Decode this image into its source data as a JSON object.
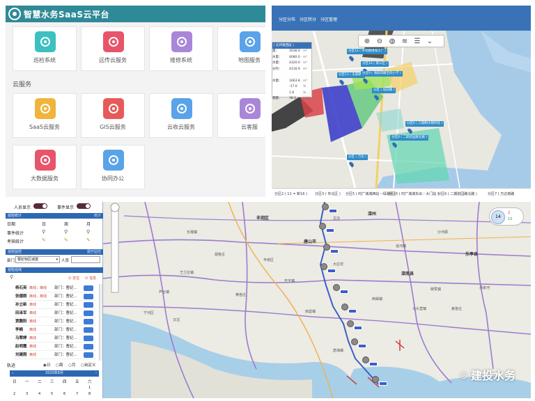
{
  "saas": {
    "title": "智慧水务SaaS云平台",
    "section": "云服务",
    "row1": [
      {
        "label": "巡检系统",
        "color": "#3cc0c0"
      },
      {
        "label": "远传云服务",
        "color": "#e8546a"
      },
      {
        "label": "维修系统",
        "color": "#a987d8"
      },
      {
        "label": "地图服务",
        "color": "#5aa3e8"
      }
    ],
    "row2": [
      {
        "label": "SaaS云服务",
        "color": "#f0b43c"
      },
      {
        "label": "GIS云服务",
        "color": "#e85a5a"
      },
      {
        "label": "云收云服务",
        "color": "#5aa3e8"
      },
      {
        "label": "云客服",
        "color": "#a987d8"
      }
    ],
    "row3": [
      {
        "label": "大数据服务",
        "color": "#e8546a"
      },
      {
        "label": "协同办公",
        "color": "#5aa3e8"
      }
    ]
  },
  "dispatch": {
    "nav": [
      "分区分布",
      "分区转分",
      "分区管理"
    ],
    "table": {
      "header": "( 北环路西段 )",
      "rows": [
        {
          "k": "量：",
          "v": "1636.0",
          "u": "m³"
        },
        {
          "k": "水量：",
          "v": "4080.0",
          "u": "m³"
        },
        {
          "k": "水量：",
          "v": "4320.0",
          "u": "m³"
        },
        {
          "k": "分时：",
          "v": "4116.9",
          "u": "m³"
        },
        {
          "k": "",
          "v": "",
          "u": ""
        },
        {
          "k": "水量：",
          "v": "1663.8",
          "u": "m³"
        },
        {
          "k": "",
          ":": "",
          "v": "-17.0",
          "u": "%"
        },
        {
          "k": "",
          "v": "1.8",
          "u": "%"
        },
        {
          "k": "漏量：",
          "v": "38.0",
          "u": "m³/h"
        }
      ]
    },
    "zones": [
      {
        "label": "分区12 ( 中华路博海工厂 )"
      },
      {
        "label": "分区10 ( 南三区 )"
      },
      {
        "label": "分区11 ( 东部路 )"
      },
      {
        "label": "分区9 ( 海底四路至四小学 )"
      },
      {
        "label": "分区 ( 站前路 )"
      },
      {
        "label": "分区6 ( 三期制水暂时处 )"
      },
      {
        "label": "分区8 ( 二期前园路北路 )"
      },
      {
        "label": "分区 ( 万达 )"
      }
    ],
    "tabs": [
      "分区2 ( 11 = 新16 )",
      "分区3 ( 市北区 )",
      "分区5 ( 时广城城西站・绿湖区 )",
      "分区5 ( 时广城城东出・大门站 )",
      "分区6 ( 二期前园路北路 )",
      "分区7 ( 万达南路"
    ]
  },
  "tracking": {
    "toggles": {
      "person": "人员显示",
      "event": "事件显示"
    },
    "stats": {
      "bar": "巡检统计",
      "bar_right": "统计",
      "cols": [
        "日期",
        "日",
        "周",
        "月"
      ],
      "rows": [
        "事件统计",
        "考核统计"
      ]
    },
    "monitor": {
      "bar": "巡检监控",
      "bar_right": "展开监控",
      "dept_label": "部门",
      "dept_value": "曹妃甸区城建",
      "person_label": "人员"
    },
    "list": {
      "bar": "巡检巡线",
      "chk1": "定位",
      "chk2": "信息"
    },
    "people": [
      {
        "name": "杨石英",
        "status": "离线，离线",
        "dept": "部门：曹妃..."
      },
      {
        "name": "张德刚",
        "status": "离线，离线",
        "dept": "部门：曹妃..."
      },
      {
        "name": "孙立新",
        "status": "离线",
        "dept": "部门：曹妃..."
      },
      {
        "name": "田泽军",
        "status": "离线",
        "dept": "部门：曹妃..."
      },
      {
        "name": "贾鹏阳",
        "status": "离线",
        "dept": "部门：曹妃..."
      },
      {
        "name": "李楠",
        "status": "离线",
        "dept": "部门：曹妃..."
      },
      {
        "name": "马翠婷",
        "status": "离线",
        "dept": "部门：曹妃..."
      },
      {
        "name": "赵明霞",
        "status": "离线",
        "dept": "部门：曹妃..."
      },
      {
        "name": "刘建刚",
        "status": "离线",
        "dept": "部门：曹妃..."
      }
    ],
    "track": {
      "label": "轨迹",
      "options": [
        "日",
        "周",
        "月",
        "自定义"
      ]
    },
    "calendar": {
      "month": "2020年8月",
      "days": [
        "日",
        "一",
        "二",
        "三",
        "四",
        "五",
        "六"
      ],
      "row1": [
        "",
        "",
        "",
        "",
        "",
        "",
        "1"
      ],
      "row2": [
        "2",
        "3",
        "4",
        "5",
        "6",
        "7",
        "8"
      ]
    },
    "map_labels": {
      "cities": [
        "唐山市",
        "滦南县",
        "乐亭县",
        "滦州",
        "丰润区"
      ],
      "small": [
        "丰南区",
        "汉沽",
        "宁河区",
        "芦台镇",
        "南堡镇",
        "唐海镇",
        "柳赞镇",
        "马头营镇",
        "西渠镇",
        "姜各庄",
        "汤家河",
        "长凝镇",
        "胡各庄",
        "古冶",
        "沙河驿",
        "开平镇",
        "黄各庄",
        "道河镇",
        "王兰庄镇",
        "大庄坨"
      ]
    },
    "legend": {
      "a": "2",
      "b": "13",
      "c": "14"
    },
    "watermark": "建投水务"
  }
}
